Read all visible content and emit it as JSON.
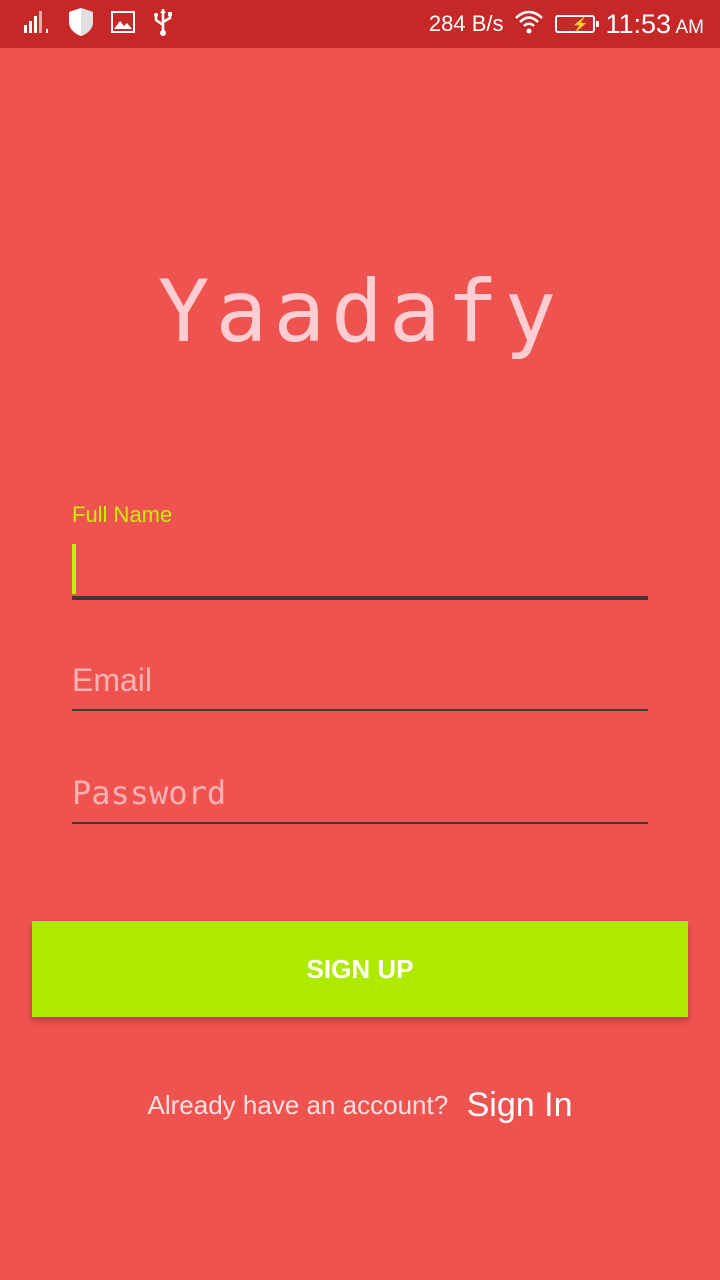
{
  "status_bar": {
    "icons": [
      "signal-icon",
      "shield-icon",
      "image-icon",
      "usb-icon",
      "wifi-icon",
      "battery-charging-icon"
    ],
    "network_speed": "284 B/s",
    "time": "11:53",
    "ampm": "AM"
  },
  "app": {
    "logo_text": "Yaadafy"
  },
  "form": {
    "full_name": {
      "label": "Full Name",
      "value": ""
    },
    "email": {
      "placeholder": "Email"
    },
    "password": {
      "placeholder": "Password"
    },
    "signup_label": "SIGN UP"
  },
  "footer": {
    "prompt": "Already have an account?",
    "signin_label": "Sign In"
  },
  "colors": {
    "background": "#ef5350",
    "status_bar": "#c62828",
    "accent": "#aeea00"
  }
}
